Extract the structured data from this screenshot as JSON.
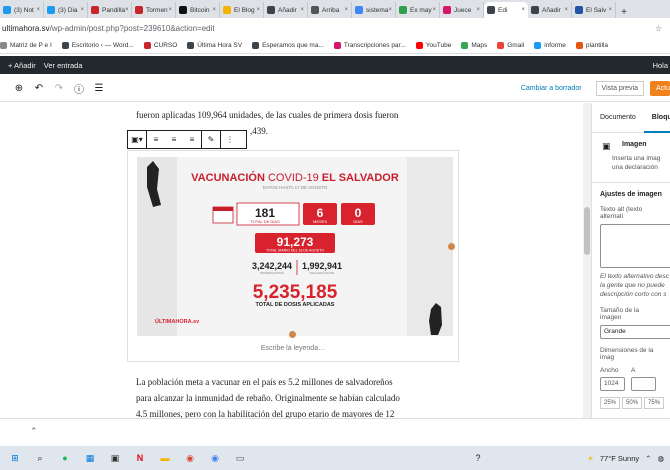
{
  "browser": {
    "tabs": [
      {
        "label": "(3) Not",
        "color": "#1d9bf0",
        "active": false
      },
      {
        "label": "(3) Dia",
        "color": "#1d9bf0",
        "active": false
      },
      {
        "label": "Pandilla",
        "color": "#c9252c",
        "active": false
      },
      {
        "label": "Tormen",
        "color": "#c9252c",
        "active": false
      },
      {
        "label": "Bitcoin",
        "color": "#111111",
        "active": false
      },
      {
        "label": "El Blog",
        "color": "#f5b400",
        "active": false
      },
      {
        "label": "Añadir",
        "color": "#3c434a",
        "active": false
      },
      {
        "label": "Arriba",
        "color": "#555555",
        "active": false
      },
      {
        "label": "sistema",
        "color": "#4285f4",
        "active": false
      },
      {
        "label": "Ex may",
        "color": "#2e9e4f",
        "active": false
      },
      {
        "label": "Juece",
        "color": "#d6156c",
        "active": false
      },
      {
        "label": "Edi",
        "color": "#3c434a",
        "active": true
      },
      {
        "label": "Añadir",
        "color": "#3c434a",
        "active": false
      },
      {
        "label": "El Salv",
        "color": "#2255aa",
        "active": false
      }
    ],
    "new_tab": "+",
    "url_host": "ultimahora.sv",
    "url_path": "/wp-admin/post.php?post=239610&action=edit",
    "bookmarks": [
      {
        "label": "Matriz de P e I",
        "color": "#888888"
      },
      {
        "label": "Escritorio ‹ — Word...",
        "color": "#3c434a"
      },
      {
        "label": "CURSO",
        "color": "#c9252c"
      },
      {
        "label": "Última Hora SV",
        "color": "#3c434a"
      },
      {
        "label": "Esperamos que ma...",
        "color": "#3c434a"
      },
      {
        "label": "Transcripciones par...",
        "color": "#d6156c"
      },
      {
        "label": "YouTube",
        "color": "#ff0000"
      },
      {
        "label": "Maps",
        "color": "#34a853"
      },
      {
        "label": "Gmail",
        "color": "#ea4335"
      },
      {
        "label": "informe",
        "color": "#1d9bf0"
      },
      {
        "label": "plantilla",
        "color": "#e8550c"
      }
    ]
  },
  "wp_admin_bar": {
    "add": "+ Añadir",
    "entries": "Ver entrada",
    "howdy": "Hola"
  },
  "editor_toolbar": {
    "switch_draft": "Cambiar a borrador",
    "preview": "Vista previa",
    "publish": "Actu"
  },
  "content": {
    "para1_line1": "fueron aplicadas 109,964 unidades, de las cuales de primera dosis fueron",
    "para1_line2": ",439.",
    "caption_placeholder": "Escribe la leyenda…",
    "para2_line1": "La población meta a vacunar en el país es 5.2 millones de salvadoreños",
    "para2_line2": "para alcanzar la inmunidad de rebaño. Originalmente se habían calculado",
    "para2_line3": "4.5 millones, pero con la habilitación del grupo etario de mayores de 12"
  },
  "infographic": {
    "title_a": "VACUNACIÓN",
    "title_b": "COVID-19",
    "title_c": "EL SALVADOR",
    "subtitle": "DATOS HASTA 17 DE AGOSTO",
    "days_value": "181",
    "days_label": "TOTAL DE DÍAS",
    "months_value": "6",
    "months_label": "MESES",
    "days2_value": "0",
    "days2_label": "DÍAS",
    "daily_value": "91,273",
    "daily_label": "TOTAL DIARIO DEL 16 DE AGOSTO",
    "first_value": "3,242,244",
    "first_label": "PRIMERA DOSIS",
    "second_value": "1,992,941",
    "second_label": "SEGUNDA DOSIS",
    "total_value": "5,235,185",
    "total_label": "TOTAL DE DOSIS APLICADAS",
    "logo": "ÚLTIMAHORA.sv"
  },
  "sidebar": {
    "tab_document": "Documento",
    "tab_block": "Bloque",
    "block_title": "Imagen",
    "block_desc_1": "Inserta una imag",
    "block_desc_2": "una declaración",
    "settings_title": "Ajustes de imagen",
    "alt_label": "Texto alt (texto alternati",
    "alt_help_1": "El texto alternativo desc",
    "alt_help_2": "la gente que no puede",
    "alt_help_3": "descripción corto con s",
    "size_label": "Tamaño de la imagen",
    "size_value": "Grande",
    "dims_label": "Dimensiones de la imag",
    "width_label": "Ancho",
    "height_label": "A",
    "width_value": "1024",
    "pcts": [
      "25%",
      "50%",
      "75%"
    ]
  },
  "taskbar": {
    "weather": "77°F  Sunny"
  }
}
